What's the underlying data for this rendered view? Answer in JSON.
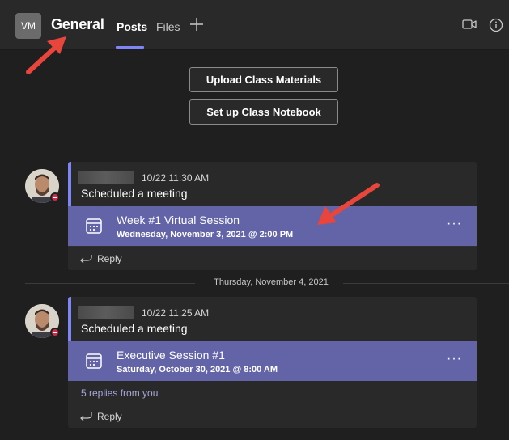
{
  "header": {
    "team_initials": "VM",
    "channel_name": "General",
    "tabs": [
      {
        "label": "Posts",
        "active": true
      },
      {
        "label": "Files",
        "active": false
      }
    ]
  },
  "actions": {
    "upload_label": "Upload Class Materials",
    "notebook_label": "Set up Class Notebook"
  },
  "posts": [
    {
      "timestamp": "10/22 11:30 AM",
      "text": "Scheduled a meeting",
      "meeting_title": "Week #1 Virtual Session",
      "meeting_date": "Wednesday, November 3, 2021 @ 2:00 PM",
      "more_label": "···",
      "reply_label": "Reply"
    },
    {
      "timestamp": "10/22 11:25 AM",
      "text": "Scheduled a meeting",
      "meeting_title": "Executive Session #1",
      "meeting_date": "Saturday, October 30, 2021 @ 8:00 AM",
      "more_label": "···",
      "replies_link": "5 replies from you",
      "reply_label": "Reply"
    }
  ],
  "date_divider": "Thursday, November 4, 2021",
  "colors": {
    "accent": "#7f85f5",
    "meeting_card": "#6264a7",
    "annotation_arrow": "#e8453c"
  },
  "icons": [
    "add-tab-icon",
    "video-call-icon",
    "info-icon",
    "calendar-icon",
    "reply-icon"
  ]
}
